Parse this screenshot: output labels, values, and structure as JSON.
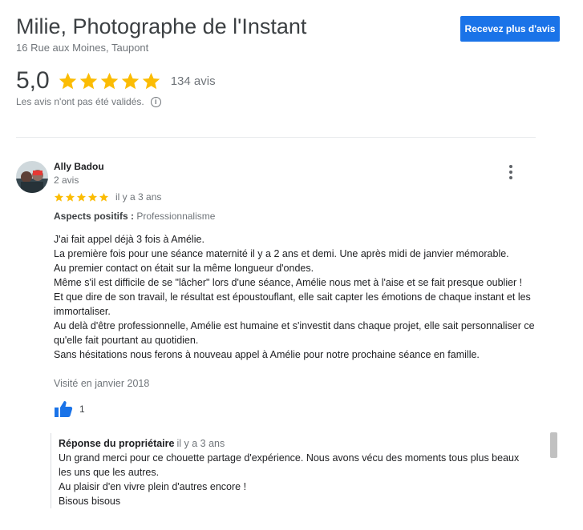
{
  "business": {
    "name": "Milie, Photographe de l'Instant",
    "address": "16 Rue aux Moines, Taupont",
    "cta_label": "Recevez plus d'avis",
    "rating": "5,0",
    "stars": 5,
    "reviews_count": "134 avis",
    "not_validated": "Les avis n'ont pas été validés.",
    "info_icon_glyph": "i"
  },
  "colors": {
    "accent": "#1a73e8",
    "star": "#fbbc04",
    "muted_text": "#70757a"
  },
  "icons": [
    "star-icon",
    "info-icon",
    "more-vert-icon",
    "thumbs-up-icon",
    "avatar"
  ],
  "review": {
    "author": "Ally Badou",
    "author_meta": "2 avis",
    "stars": 5,
    "date": "il y a 3 ans",
    "aspects_label": "Aspects positifs :",
    "aspects_value": "Professionnalisme",
    "body_lines": [
      "J'ai fait appel déjà 3 fois à Amélie.",
      "La première fois pour une séance maternité il y a 2 ans et demi. Une après midi de janvier mémorable.",
      "Au premier contact on était sur la même longueur d'ondes.",
      "Même s'il est difficile de se \"lâcher\" lors d'une séance, Amélie nous met à l'aise et se fait presque oublier !",
      "Et que dire de son travail, le résultat est époustouflant, elle sait capter les émotions de chaque instant et les immortaliser.",
      "Au delà d'être professionnelle, Amélie est humaine et s'investit dans chaque projet, elle sait personnaliser ce qu'elle fait pourtant au quotidien.",
      "Sans hésitations nous ferons à nouveau appel à Amélie pour notre prochaine séance en famille."
    ],
    "visited": "Visité en janvier 2018",
    "likes": "1"
  },
  "owner_reply": {
    "label": "Réponse du propriétaire",
    "date": "il y a 3 ans",
    "body_lines": [
      "Un grand merci pour ce chouette partage d'expérience. Nous avons vécu des moments tous plus beaux les uns que les autres.",
      "Au plaisir d'en vivre plein d'autres encore !",
      "Bisous bisous"
    ]
  }
}
